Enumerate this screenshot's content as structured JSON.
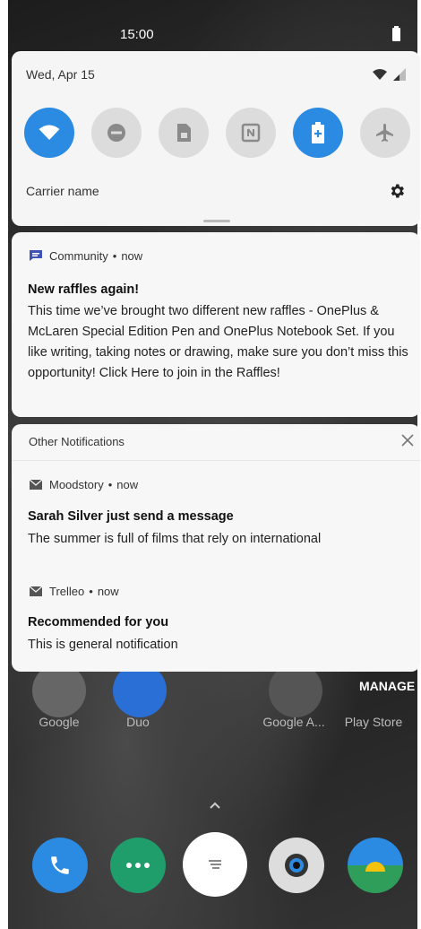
{
  "status_bar": {
    "time": "15:00"
  },
  "quick_settings": {
    "date": "Wed, Apr 15",
    "carrier": "Carrier name",
    "tiles": [
      {
        "name": "wifi",
        "on": true
      },
      {
        "name": "do-not-disturb",
        "on": false
      },
      {
        "name": "sim",
        "on": false
      },
      {
        "name": "nfc",
        "on": false
      },
      {
        "name": "battery-saver",
        "on": true
      },
      {
        "name": "airplane-mode",
        "on": false
      }
    ]
  },
  "community_notification": {
    "app": "Community",
    "time": "now",
    "title": "New raffles again!",
    "body": "This time we’ve brought two different new raffles - OnePlus & McLaren Special Edition Pen and OnePlus Notebook Set. If you like writing, taking notes or drawing, make sure you don’t miss this opportunity! Click Here to join in the Raffles!"
  },
  "other_notifications": {
    "header": "Other Notifications",
    "items": [
      {
        "app": "Moodstory",
        "time": "now",
        "title": "Sarah Silver just send a message",
        "body": "The summer is full of films that rely on international"
      },
      {
        "app": "Trelleo",
        "time": "now",
        "title": "Recommended for you",
        "body": "This is general notification"
      }
    ]
  },
  "manage_label": "MANAGE",
  "home_apps": [
    "Google",
    "Duo",
    "Google A...",
    "Play Store"
  ],
  "colors": {
    "accent": "#2b8ae2",
    "community_icon": "#3f51b5"
  }
}
